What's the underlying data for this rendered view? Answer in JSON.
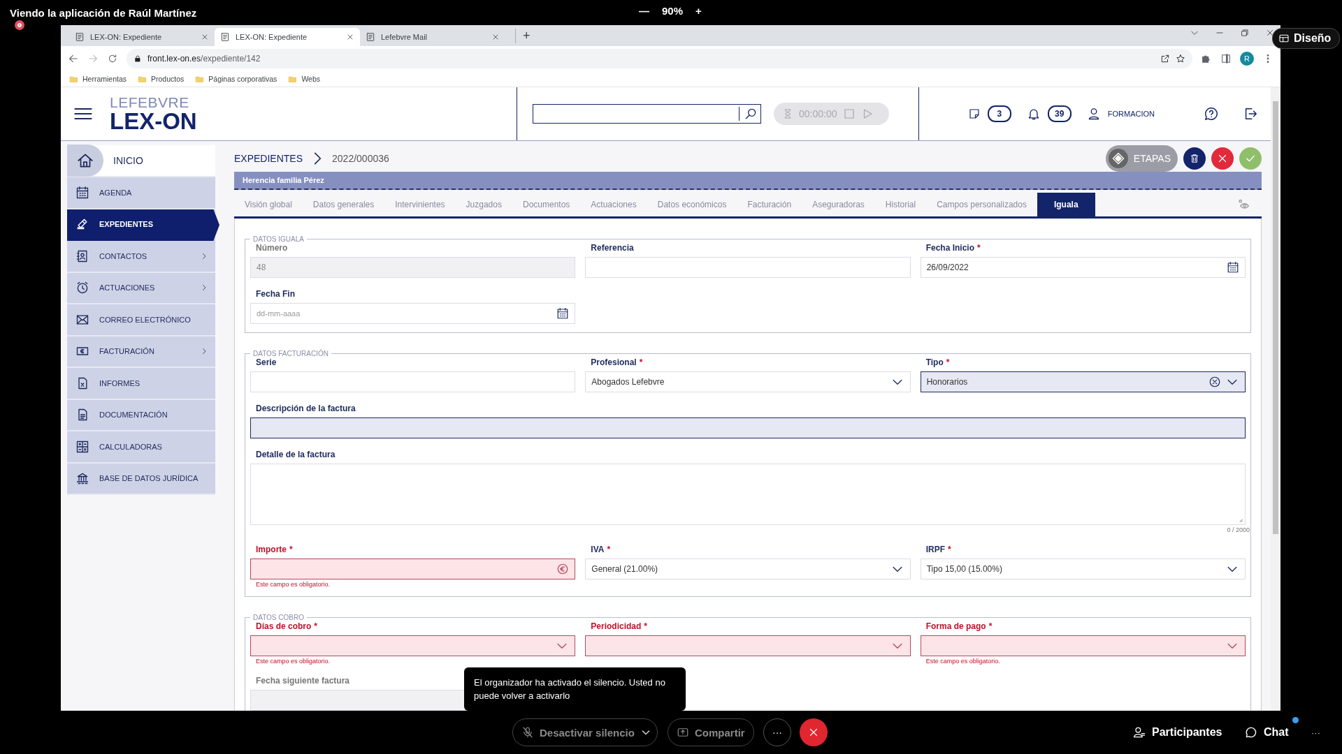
{
  "meeting": {
    "viewing_title": "Viendo la aplicación de Raúl Martínez",
    "zoom_out": "—",
    "zoom_level": "90%",
    "zoom_in": "+",
    "layout_button": "Diseño"
  },
  "browser": {
    "tabs": [
      {
        "title": "LEX-ON: Expediente",
        "selected": false
      },
      {
        "title": "LEX-ON: Expediente",
        "selected": true
      },
      {
        "title": "Lefebvre Mail",
        "selected": false
      }
    ],
    "new_tab": "+",
    "url_host": "front.lex-on.es",
    "url_path": "/expediente/142",
    "profile_initial": "R",
    "bookmarks": [
      "Herramientas",
      "Productos",
      "Páginas corporativas",
      "Webs"
    ]
  },
  "app": {
    "logo_top": "LEFEBVRE",
    "logo_bottom": "LEX-ON",
    "timer": "00:00:00",
    "notes_count": "3",
    "notifications_count": "39",
    "user": "FORMACION",
    "sidebar": [
      {
        "label": "INICIO",
        "selected": false,
        "has_submenu": false
      },
      {
        "label": "AGENDA",
        "selected": false,
        "has_submenu": false
      },
      {
        "label": "EXPEDIENTES",
        "selected": true,
        "has_submenu": false
      },
      {
        "label": "CONTACTOS",
        "selected": false,
        "has_submenu": true
      },
      {
        "label": "ACTUACIONES",
        "selected": false,
        "has_submenu": true
      },
      {
        "label": "CORREO ELECTRÓNICO",
        "selected": false,
        "has_submenu": false
      },
      {
        "label": "FACTURACIÓN",
        "selected": false,
        "has_submenu": true
      },
      {
        "label": "INFORMES",
        "selected": false,
        "has_submenu": false
      },
      {
        "label": "DOCUMENTACIÓN",
        "selected": false,
        "has_submenu": false
      },
      {
        "label": "CALCULADORAS",
        "selected": false,
        "has_submenu": false
      },
      {
        "label": "BASE DE DATOS JURÍDICA",
        "selected": false,
        "has_submenu": false
      }
    ],
    "breadcrumb": [
      "EXPEDIENTES",
      "2022/000036"
    ],
    "stages_button": "ETAPAS",
    "case_title": "Herencia familia Pérez",
    "tabs": [
      {
        "label": "Visión global",
        "selected": false
      },
      {
        "label": "Datos generales",
        "selected": false
      },
      {
        "label": "Intervinientes",
        "selected": false
      },
      {
        "label": "Juzgados",
        "selected": false
      },
      {
        "label": "Documentos",
        "selected": false
      },
      {
        "label": "Actuaciones",
        "selected": false
      },
      {
        "label": "Datos económicos",
        "selected": false
      },
      {
        "label": "Facturación",
        "selected": false
      },
      {
        "label": "Aseguradoras",
        "selected": false
      },
      {
        "label": "Historial",
        "selected": false
      },
      {
        "label": "Campos personalizados",
        "selected": false
      },
      {
        "label": "Iguala",
        "selected": true
      }
    ],
    "sections": [
      {
        "legend": "DATOS IGUALA",
        "fields": [
          {
            "kind": "text",
            "label": "Número",
            "value": "48",
            "disabled": true,
            "invalid": false,
            "highlighted": false
          },
          {
            "kind": "text",
            "label": "Referencia",
            "disabled": false,
            "invalid": false,
            "highlighted": false
          },
          {
            "kind": "date",
            "label": "Fecha Inicio",
            "required_mark": "*",
            "value": "26/09/2022",
            "disabled": false,
            "invalid": false,
            "highlighted": false
          },
          {
            "kind": "date",
            "label": "Fecha Fin",
            "placeholder": "dd-mm-aaaa",
            "disabled": false,
            "invalid": false,
            "highlighted": false
          }
        ]
      },
      {
        "legend": "DATOS FACTURACIÓN",
        "fields": [
          {
            "kind": "text",
            "label": "Serie",
            "disabled": false,
            "invalid": false,
            "highlighted": false
          },
          {
            "kind": "select",
            "label": "Profesional",
            "required_mark": "*",
            "value": "Abogados Lefebvre",
            "disabled": false,
            "invalid": false,
            "highlighted": false
          },
          {
            "kind": "select",
            "label": "Tipo",
            "required_mark": "*",
            "value": "Honorarios",
            "clearable": true,
            "disabled": false,
            "invalid": false,
            "highlighted": true
          },
          {
            "kind": "long-text",
            "label": "Descripción de la factura",
            "disabled": false,
            "invalid": false,
            "highlighted": true
          },
          {
            "kind": "textarea",
            "label": "Detalle de la factura",
            "counter": "0 / 2000",
            "disabled": false,
            "invalid": false,
            "highlighted": false
          },
          {
            "kind": "money",
            "label": "Importe",
            "required_mark": "*",
            "disabled": false,
            "invalid": true,
            "highlighted": false,
            "error": "Este campo es obligatorio."
          },
          {
            "kind": "select",
            "label": "IVA",
            "required_mark": "*",
            "value": "General (21.00%)",
            "disabled": false,
            "invalid": false,
            "highlighted": false
          },
          {
            "kind": "select",
            "label": "IRPF",
            "required_mark": "*",
            "value": "Tipo 15,00 (15.00%)",
            "disabled": false,
            "invalid": false,
            "highlighted": false
          }
        ]
      },
      {
        "legend": "DATOS COBRO",
        "fields": [
          {
            "kind": "select",
            "label": "Días de cobro",
            "required_mark": "*",
            "disabled": false,
            "invalid": true,
            "highlighted": false,
            "error": "Este campo es obligatorio."
          },
          {
            "kind": "select",
            "label": "Periodicidad",
            "required_mark": "*",
            "disabled": false,
            "invalid": true,
            "highlighted": false
          },
          {
            "kind": "select",
            "label": "Forma de pago",
            "required_mark": "*",
            "disabled": false,
            "invalid": true,
            "highlighted": false,
            "error": "Este campo es obligatorio."
          },
          {
            "kind": "text",
            "label": "Fecha siguiente factura",
            "disabled": true,
            "invalid": false,
            "highlighted": false
          }
        ]
      }
    ]
  },
  "toast": "El organizador ha activado el silencio. Usted no puede volver a activarlo",
  "call_controls": {
    "mute_button": {
      "label": "Desactivar silencio",
      "disabled": true
    },
    "share_button": {
      "label": "Compartir",
      "disabled": true
    },
    "more": "···",
    "participants": "Participantes",
    "chat": "Chat",
    "chat_unread": true,
    "overflow": "···"
  }
}
